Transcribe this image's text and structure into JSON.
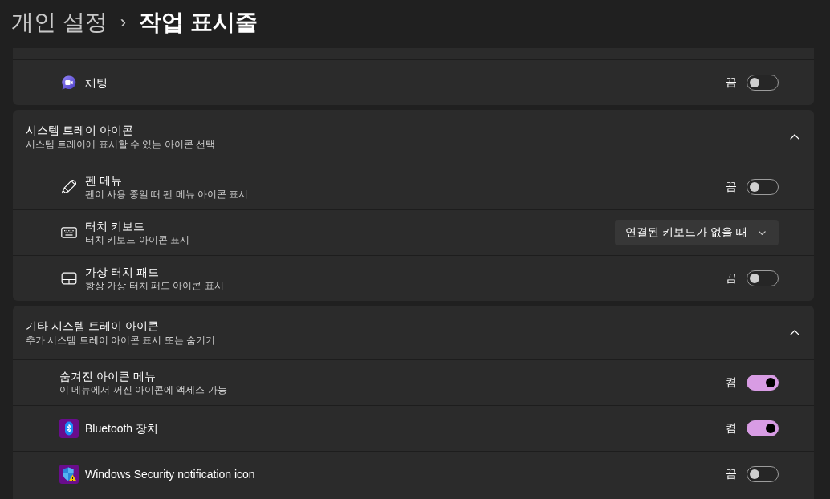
{
  "breadcrumb": {
    "parent": "개인 설정",
    "separator": "›",
    "current": "작업 표시줄"
  },
  "sections": [
    {
      "rows": [
        {
          "kind": "toggle",
          "title": "채팅",
          "state_label": "끔",
          "on": false
        }
      ]
    },
    {
      "title": "시스템 트레이 아이콘",
      "subtitle": "시스템 트레이에 표시할 수 있는 아이콘 선택",
      "expanded": true,
      "rows": [
        {
          "kind": "toggle",
          "title": "펜 메뉴",
          "subtitle": "펜이 사용 중일 때 펜 메뉴 아이콘 표시",
          "state_label": "끔",
          "on": false
        },
        {
          "kind": "dropdown",
          "title": "터치 키보드",
          "subtitle": "터치 키보드 아이콘 표시",
          "value": "연결된 키보드가 없을 때"
        },
        {
          "kind": "toggle",
          "title": "가상 터치 패드",
          "subtitle": "항상 가상 터치 패드 아이콘 표시",
          "state_label": "끔",
          "on": false
        }
      ]
    },
    {
      "title": "기타 시스템 트레이 아이콘",
      "subtitle": "추가 시스템 트레이 아이콘 표시 또는 숨기기",
      "expanded": true,
      "rows": [
        {
          "kind": "toggle",
          "title": "숨겨진 아이콘 메뉴",
          "subtitle": "이 메뉴에서 꺼진 아이콘에 액세스 가능",
          "state_label": "켬",
          "on": true
        },
        {
          "kind": "toggle",
          "title": "Bluetooth 장치",
          "state_label": "켬",
          "on": true
        },
        {
          "kind": "toggle",
          "title": "Windows Security notification icon",
          "state_label": "끔",
          "on": false
        }
      ]
    }
  ]
}
